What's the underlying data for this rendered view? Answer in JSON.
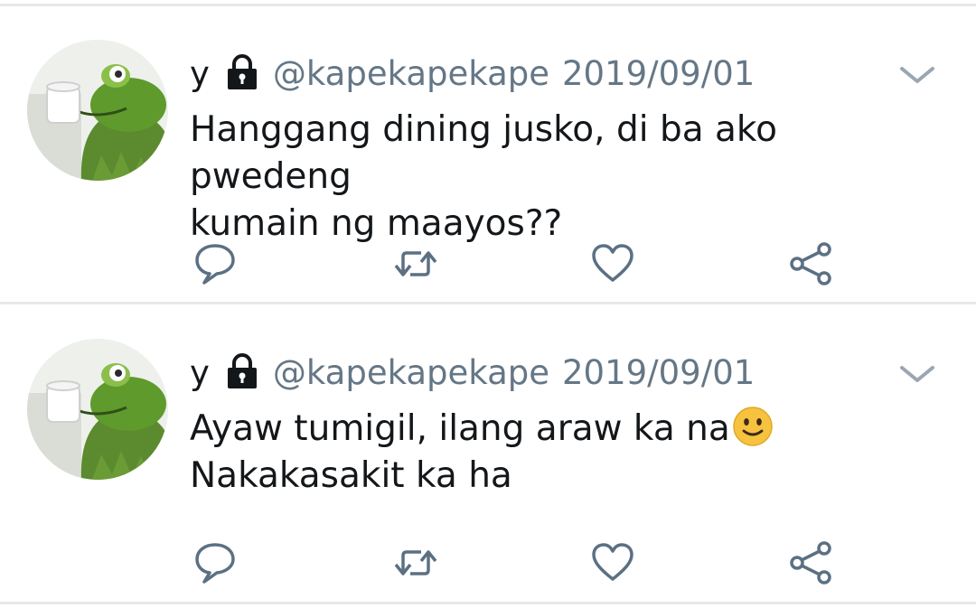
{
  "tweets": [
    {
      "name": "y",
      "handle": "@kapekapekape",
      "date": "2019/09/01",
      "lines": [
        "Hanggang dining jusko, di ba ako pwedeng",
        "kumain ng maayos??"
      ],
      "emoji": ""
    },
    {
      "name": "y",
      "handle": "@kapekapekape",
      "date": "2019/09/01",
      "lines": [
        "Ayaw tumigil, ilang araw ka na",
        "Nakakasakit ka ha"
      ],
      "emoji": "slightly-smiling-face"
    }
  ],
  "icons": {
    "lock": "lock-icon",
    "menu": "chevron-down-icon",
    "reply": "reply-icon",
    "retweet": "retweet-icon",
    "like": "heart-icon",
    "share": "share-icon"
  },
  "colors": {
    "text": "#14171a",
    "muted": "#657786",
    "separator": "#e6e8ea",
    "emoji": "#f7c23e"
  }
}
